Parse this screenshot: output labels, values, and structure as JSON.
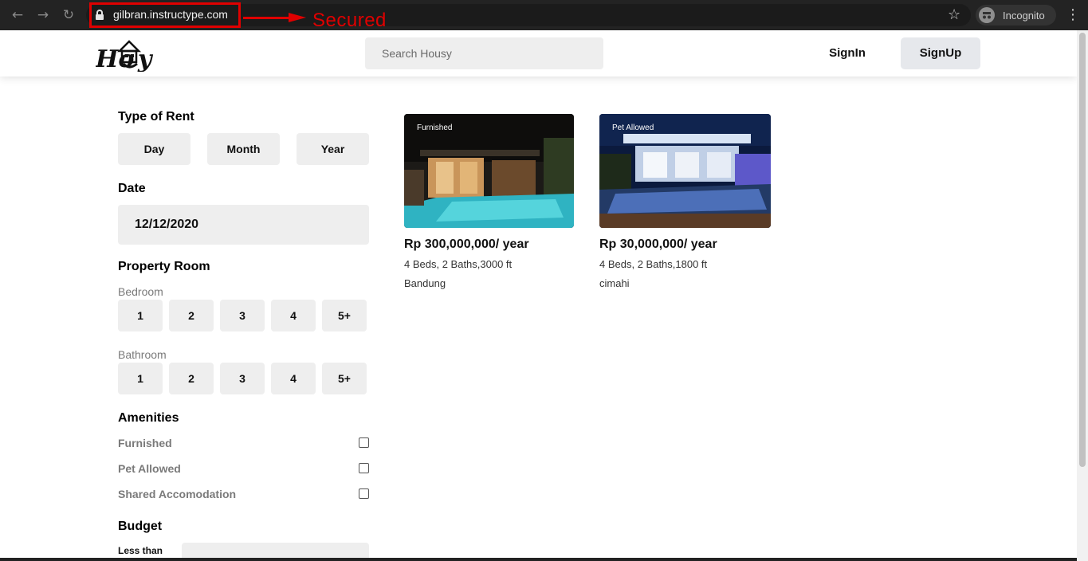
{
  "browser": {
    "url": "gilbran.instructype.com",
    "annotation": "Secured",
    "profile_label": "Incognito",
    "icons": [
      "back-icon",
      "forward-icon",
      "reload-icon",
      "lock-icon",
      "star-icon",
      "incognito-icon",
      "menu-icon"
    ]
  },
  "header": {
    "logo_text": "Housy",
    "search_placeholder": "Search Housy",
    "signin_label": "SignIn",
    "signup_label": "SignUp"
  },
  "filters": {
    "type_of_rent": {
      "title": "Type of Rent",
      "options": [
        "Day",
        "Month",
        "Year"
      ]
    },
    "date": {
      "title": "Date",
      "value": "12/12/2020"
    },
    "property_room": {
      "title": "Property Room",
      "bedroom_label": "Bedroom",
      "bedroom_options": [
        "1",
        "2",
        "3",
        "4",
        "5+"
      ],
      "bathroom_label": "Bathroom",
      "bathroom_options": [
        "1",
        "2",
        "3",
        "4",
        "5+"
      ]
    },
    "amenities": {
      "title": "Amenities",
      "items": [
        "Furnished",
        "Pet Allowed",
        "Shared Accomodation"
      ]
    },
    "budget": {
      "title": "Budget",
      "less_than_label": "Less than"
    }
  },
  "listings": [
    {
      "tag": "Furnished",
      "price": "Rp 300,000,000/ year",
      "specs": "4 Beds, 2 Baths,3000 ft",
      "city": "Bandung"
    },
    {
      "tag": "Pet Allowed",
      "price": "Rp 30,000,000/ year",
      "specs": "4 Beds, 2 Baths,1800 ft",
      "city": "cimahi"
    }
  ],
  "colors": {
    "annotation_red": "#e00000",
    "chip_bg": "#eeeeee",
    "signup_bg": "#e6e8ec"
  }
}
